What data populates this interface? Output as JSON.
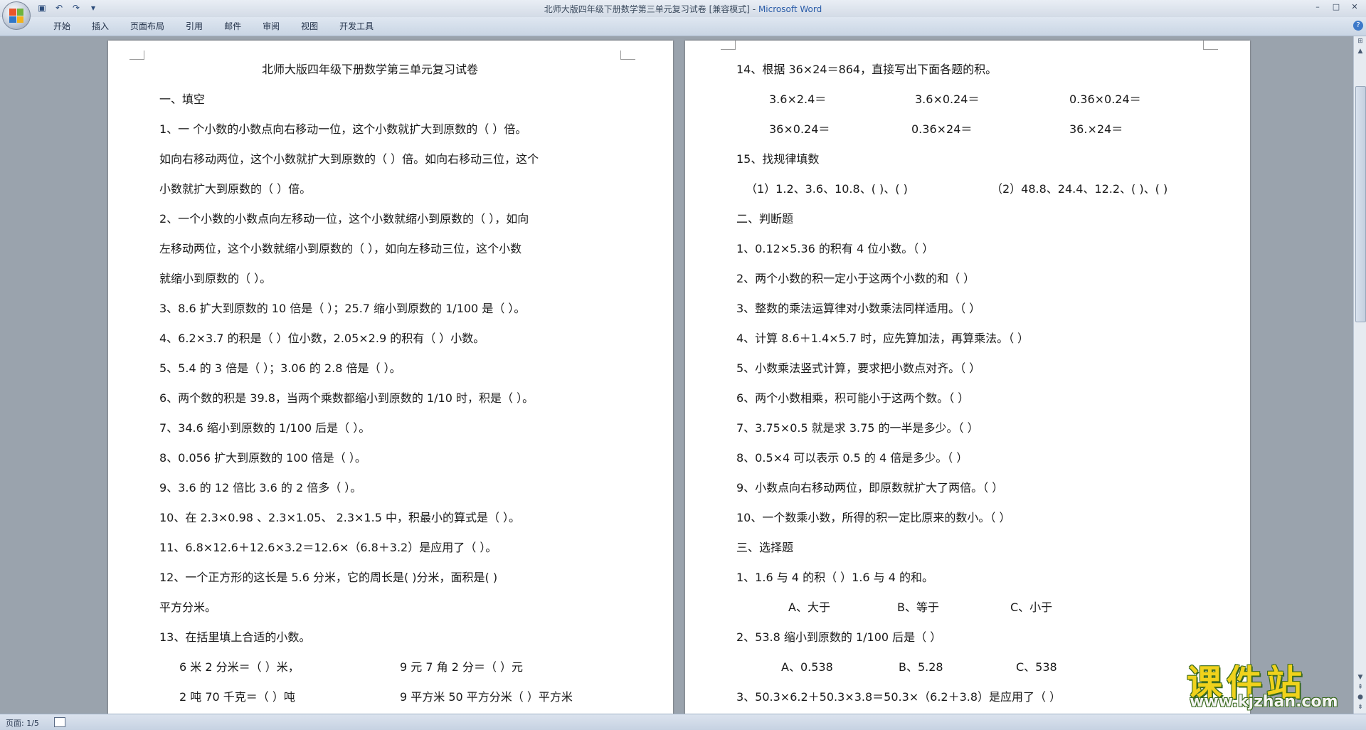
{
  "window": {
    "title": "北师大版四年级下册数学第三单元复习试卷 [兼容模式]",
    "title_sep": " - ",
    "app_name": "Microsoft Word"
  },
  "ribbon": {
    "tabs": [
      "开始",
      "插入",
      "页面布局",
      "引用",
      "邮件",
      "审阅",
      "视图",
      "开发工具"
    ]
  },
  "status": {
    "page": "页面: 1/5"
  },
  "watermark": {
    "big": "课件站",
    "url": "www.kjzhan.com"
  },
  "page_left": {
    "lines": [
      "北师大版四年级下册数学第三单元复习试卷",
      "一、填空",
      "1、一 个小数的小数点向右移动一位，这个小数就扩大到原数的（        ）倍。",
      "如向右移动两位，这个小数就扩大到原数的（       ）倍。如向右移动三位，这个",
      "小数就扩大到原数的（      ）倍。",
      "2、一个小数的小数点向左移动一位，这个小数就缩小到原数的（        ），如向",
      "左移动两位，这个小数就缩小到原数的（          ），如向左移动三位，这个小数",
      "就缩小到原数的（         ）。",
      "3、8.6 扩大到原数的 10 倍是（          ）；25.7 缩小到原数的 1/100 是（       ）。",
      "4、6.2×3.7 的积是（        ）位小数，2.05×2.9 的积有（        ）小数。",
      "5、5.4 的 3 倍是（          ）；3.06 的 2.8 倍是（          ）。",
      "6、两个数的积是 39.8，当两个乘数都缩小到原数的 1/10 时，积是（               ）。",
      "7、34.6 缩小到原数的 1/100  后是（           ）。",
      "8、0.056 扩大到原数的 100 倍是（           ）。",
      "9、3.6 的 12 倍比 3.6 的 2 倍多（           ）。",
      "10、在 2.3×0.98  、2.3×1.05、 2.3×1.5 中，积最小的算式是（           ）。",
      "11、6.8×12.6＋12.6×3.2＝12.6×（6.8＋3.2）是应用了（                              ）。",
      "12、一个正方形的这长是 5.6 分米，它的周长是(           )分米，面积是(          )",
      "平方分米。",
      "13、在括里填上合适的小数。",
      "6 米 2 分米＝（         ）米，",
      "9 元 7 角 2 分＝（          ）元",
      "2 吨 70 千克＝（         ）吨",
      "9 平方米 50 平方分米（        ）平方米"
    ]
  },
  "page_right": {
    "lines": [
      "14、根据 36×24＝864，直接写出下面各题的积。",
      "3.6×2.4＝",
      "3.6×0.24＝",
      "0.36×0.24＝",
      "36×0.24＝",
      "0.36×24＝",
      "36.×24＝",
      "15、找规律填数",
      "（1）1.2、3.6、10.8、(        )、(          )",
      "（2）48.8、24.4、12.2、(        )、(        )",
      "二、判断题",
      "1、0.12×5.36 的积有 4 位小数。（      ）",
      "2、两个小数的积一定小于这两个小数的和（       ）",
      "3、整数的乘法运算律对小数乘法同样适用。（       ）",
      "4、计算 8.6＋1.4×5.7 时，应先算加法，再算乘法。（       ）",
      "5、小数乘法竖式计算，要求把小数点对齐。（      ）",
      "6、两个小数相乘，积可能小于这两个数。（       ）",
      "7、3.75×0.5 就是求 3.75 的一半是多少。（       ）",
      "8、0.5×4 可以表示 0.5 的 4 倍是多少。（       ）",
      "9、小数点向右移动两位，即原数就扩大了两倍。（       ）",
      "10、一个数乘小数，所得的积一定比原来的数小。（       ）",
      "三、选择题",
      "1、1.6 与 4 的积（       ）1.6 与 4 的和。",
      "A、大于",
      "B、等于",
      "C、小于",
      "2、53.8 缩小到原数的 1/100 后是（        ）",
      "A、0.538",
      "B、5.28",
      "C、538",
      "3、50.3×6.2＋50.3×3.8＝50.3×（6.2＋3.8）是应用了（            ）"
    ]
  },
  "colors": {
    "brand": "#2a5ca8",
    "watermark_yellow": "#f0d21c",
    "watermark_green": "#3a6a1e"
  }
}
